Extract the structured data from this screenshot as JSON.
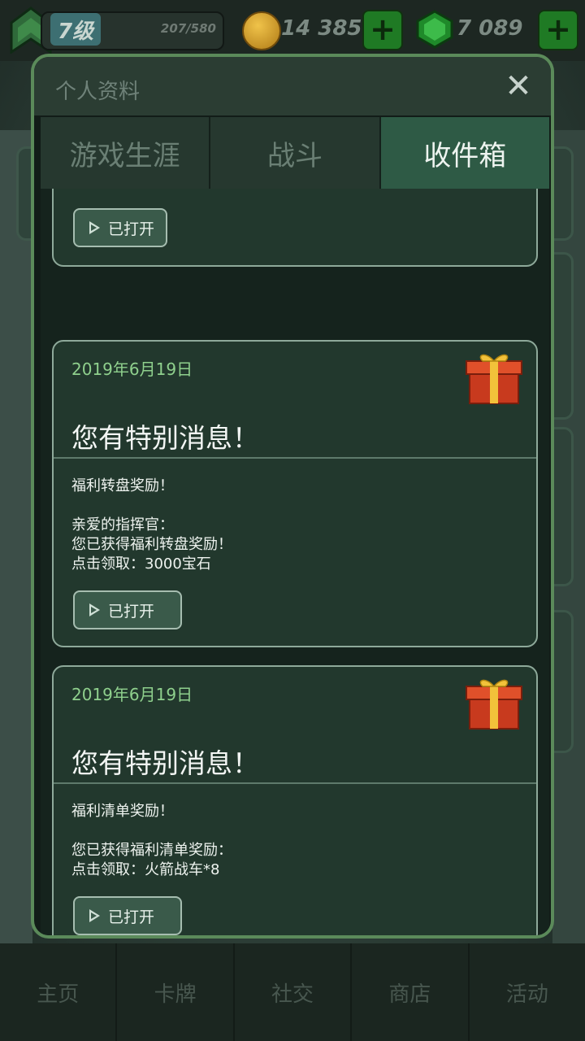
{
  "topbar": {
    "level": "7级",
    "xp": "207/580",
    "coins": "14 385",
    "gems": "7 089",
    "plus": "+"
  },
  "modal": {
    "title": "个人资料",
    "close": "✕",
    "tabs": [
      {
        "label": "游戏生涯",
        "active": false
      },
      {
        "label": "战斗",
        "active": false
      },
      {
        "label": "收件箱",
        "active": true
      }
    ]
  },
  "inbox": {
    "opened_label": "已打开",
    "messages": [
      {
        "date": "2019年6月19日",
        "headline": "您有特别消息！",
        "lines": [
          "福利转盘奖励！",
          "",
          "亲爱的指挥官：",
          "您已获得福利转盘奖励！",
          "点击领取：3000宝石"
        ]
      },
      {
        "date": "2019年6月19日",
        "headline": "您有特别消息！",
        "lines": [
          "福利清单奖励！",
          "",
          "您已获得福利清单奖励：",
          "点击领取：火箭战车*8"
        ]
      }
    ]
  },
  "background": {
    "battle_label": "战斗"
  },
  "bottom_nav": [
    "主页",
    "卡牌",
    "社交",
    "商店",
    "活动"
  ],
  "colors": {
    "accent_green": "#2e5a45",
    "date_green": "#8fd08d",
    "modal_border": "#5b8a5a"
  }
}
